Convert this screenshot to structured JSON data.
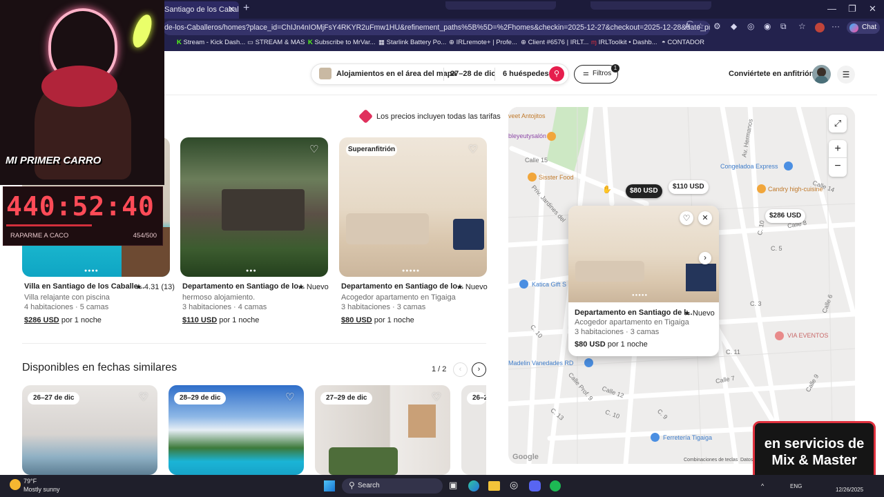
{
  "browser": {
    "tab_title": "Santiago de los Caballeros",
    "url": "de-los-Caballeros/homes?place_id=ChIJn4nIOMjFsY4RKYR2uFmw1HU&refinement_paths%5B%5D=%2Fhomes&checkin=2025-12-27&checkout=2025-12-28&date_picker_type=ca...",
    "chat_label": "Chat",
    "bookmarks": [
      "Stream - Kick Dash...",
      "STREAM & MAS",
      "Subscribe to MrVar...",
      "Starlink Battery Po...",
      "IRLremote+ | Profe...",
      "Client #6576 | IRLT...",
      "IRLToolkit • Dashb...",
      "CONTADOR"
    ]
  },
  "header": {
    "search_area": "Alojamientos en el área del mapa",
    "dates": "27–28 de dic",
    "guests": "6 huéspedes",
    "filters_label": "Filtros",
    "filters_count": "1",
    "host_link": "Conviértete en anfitrión"
  },
  "prices_note": "Los precios incluyen todas las tarifas",
  "listings": [
    {
      "title": "Villa en Santiago de los Caballe...",
      "rating": "★ 4.31 (13)",
      "desc": "Villa relajante con piscina",
      "rooms": "4 habitaciones · 5 camas",
      "price": "$286 USD",
      "per": "por 1 noche"
    },
    {
      "title": "Departamento en Santiago de lo...",
      "rating": "★ Nuevo",
      "desc": "hermoso alojamiento.",
      "rooms": "3 habitaciones · 4 camas",
      "price": "$110 USD",
      "per": "por 1 noche"
    },
    {
      "title": "Departamento en Santiago de lo...",
      "rating": "★ Nuevo",
      "desc": "Acogedor apartamento en Tigaiga",
      "rooms": "3 habitaciones · 3 camas",
      "price": "$80 USD",
      "per": "por 1 noche",
      "badge": "Superanfitrión"
    }
  ],
  "similar": {
    "title": "Disponibles en fechas similares",
    "page": "1 / 2",
    "dates": [
      "26–27 de dic",
      "28–29 de dic",
      "27–29 de dic",
      "26–2"
    ]
  },
  "map": {
    "pins": [
      "$80 USD",
      "$110 USD",
      "$286 USD"
    ],
    "pois": [
      "veet Antojitos",
      "bleyeutysalón",
      "Sisster Food",
      "Congeladoa Express",
      "Candry high-cuisine",
      "Katica Gift S",
      "VIA EVENTOS",
      "Madelin Vanedades RD",
      "Ferretería Tigaiga",
      "Google",
      "Combinaciones de teclas",
      "Datos"
    ],
    "streets": [
      "Av. Hermanos",
      "Calle 15",
      "Priv. Jardines del",
      "C. 10",
      "C. 3",
      "Calle 6",
      "C. 5",
      "C. 13",
      "Calle Prof. 9",
      "Calle 12",
      "C. 10",
      "Calle 7",
      "C. 9",
      "C. 10",
      "Calle 9",
      "C. 11",
      "Calle 8",
      "Calle 14"
    ],
    "popup": {
      "title": "Departamento en Santiago de l...",
      "rating": "★ Nuevo",
      "desc": "Acogedor apartamento en Tigaiga",
      "rooms": "3 habitaciones · 3 camas",
      "price": "$80 USD",
      "per": "por 1 noche"
    }
  },
  "stream_overlay": {
    "car_label": "MI PRIMER CARRO",
    "timer": "440:52:40",
    "goal_label": "RAPARME A CACO",
    "goal_count": "454/500",
    "goal_progress": 0.908,
    "promo": "en servicios de Mix & Master"
  },
  "taskbar": {
    "temp": "79°F",
    "weather": "Mostly sunny",
    "search": "Search",
    "lang": "ENG",
    "time": "12/26/2025"
  }
}
